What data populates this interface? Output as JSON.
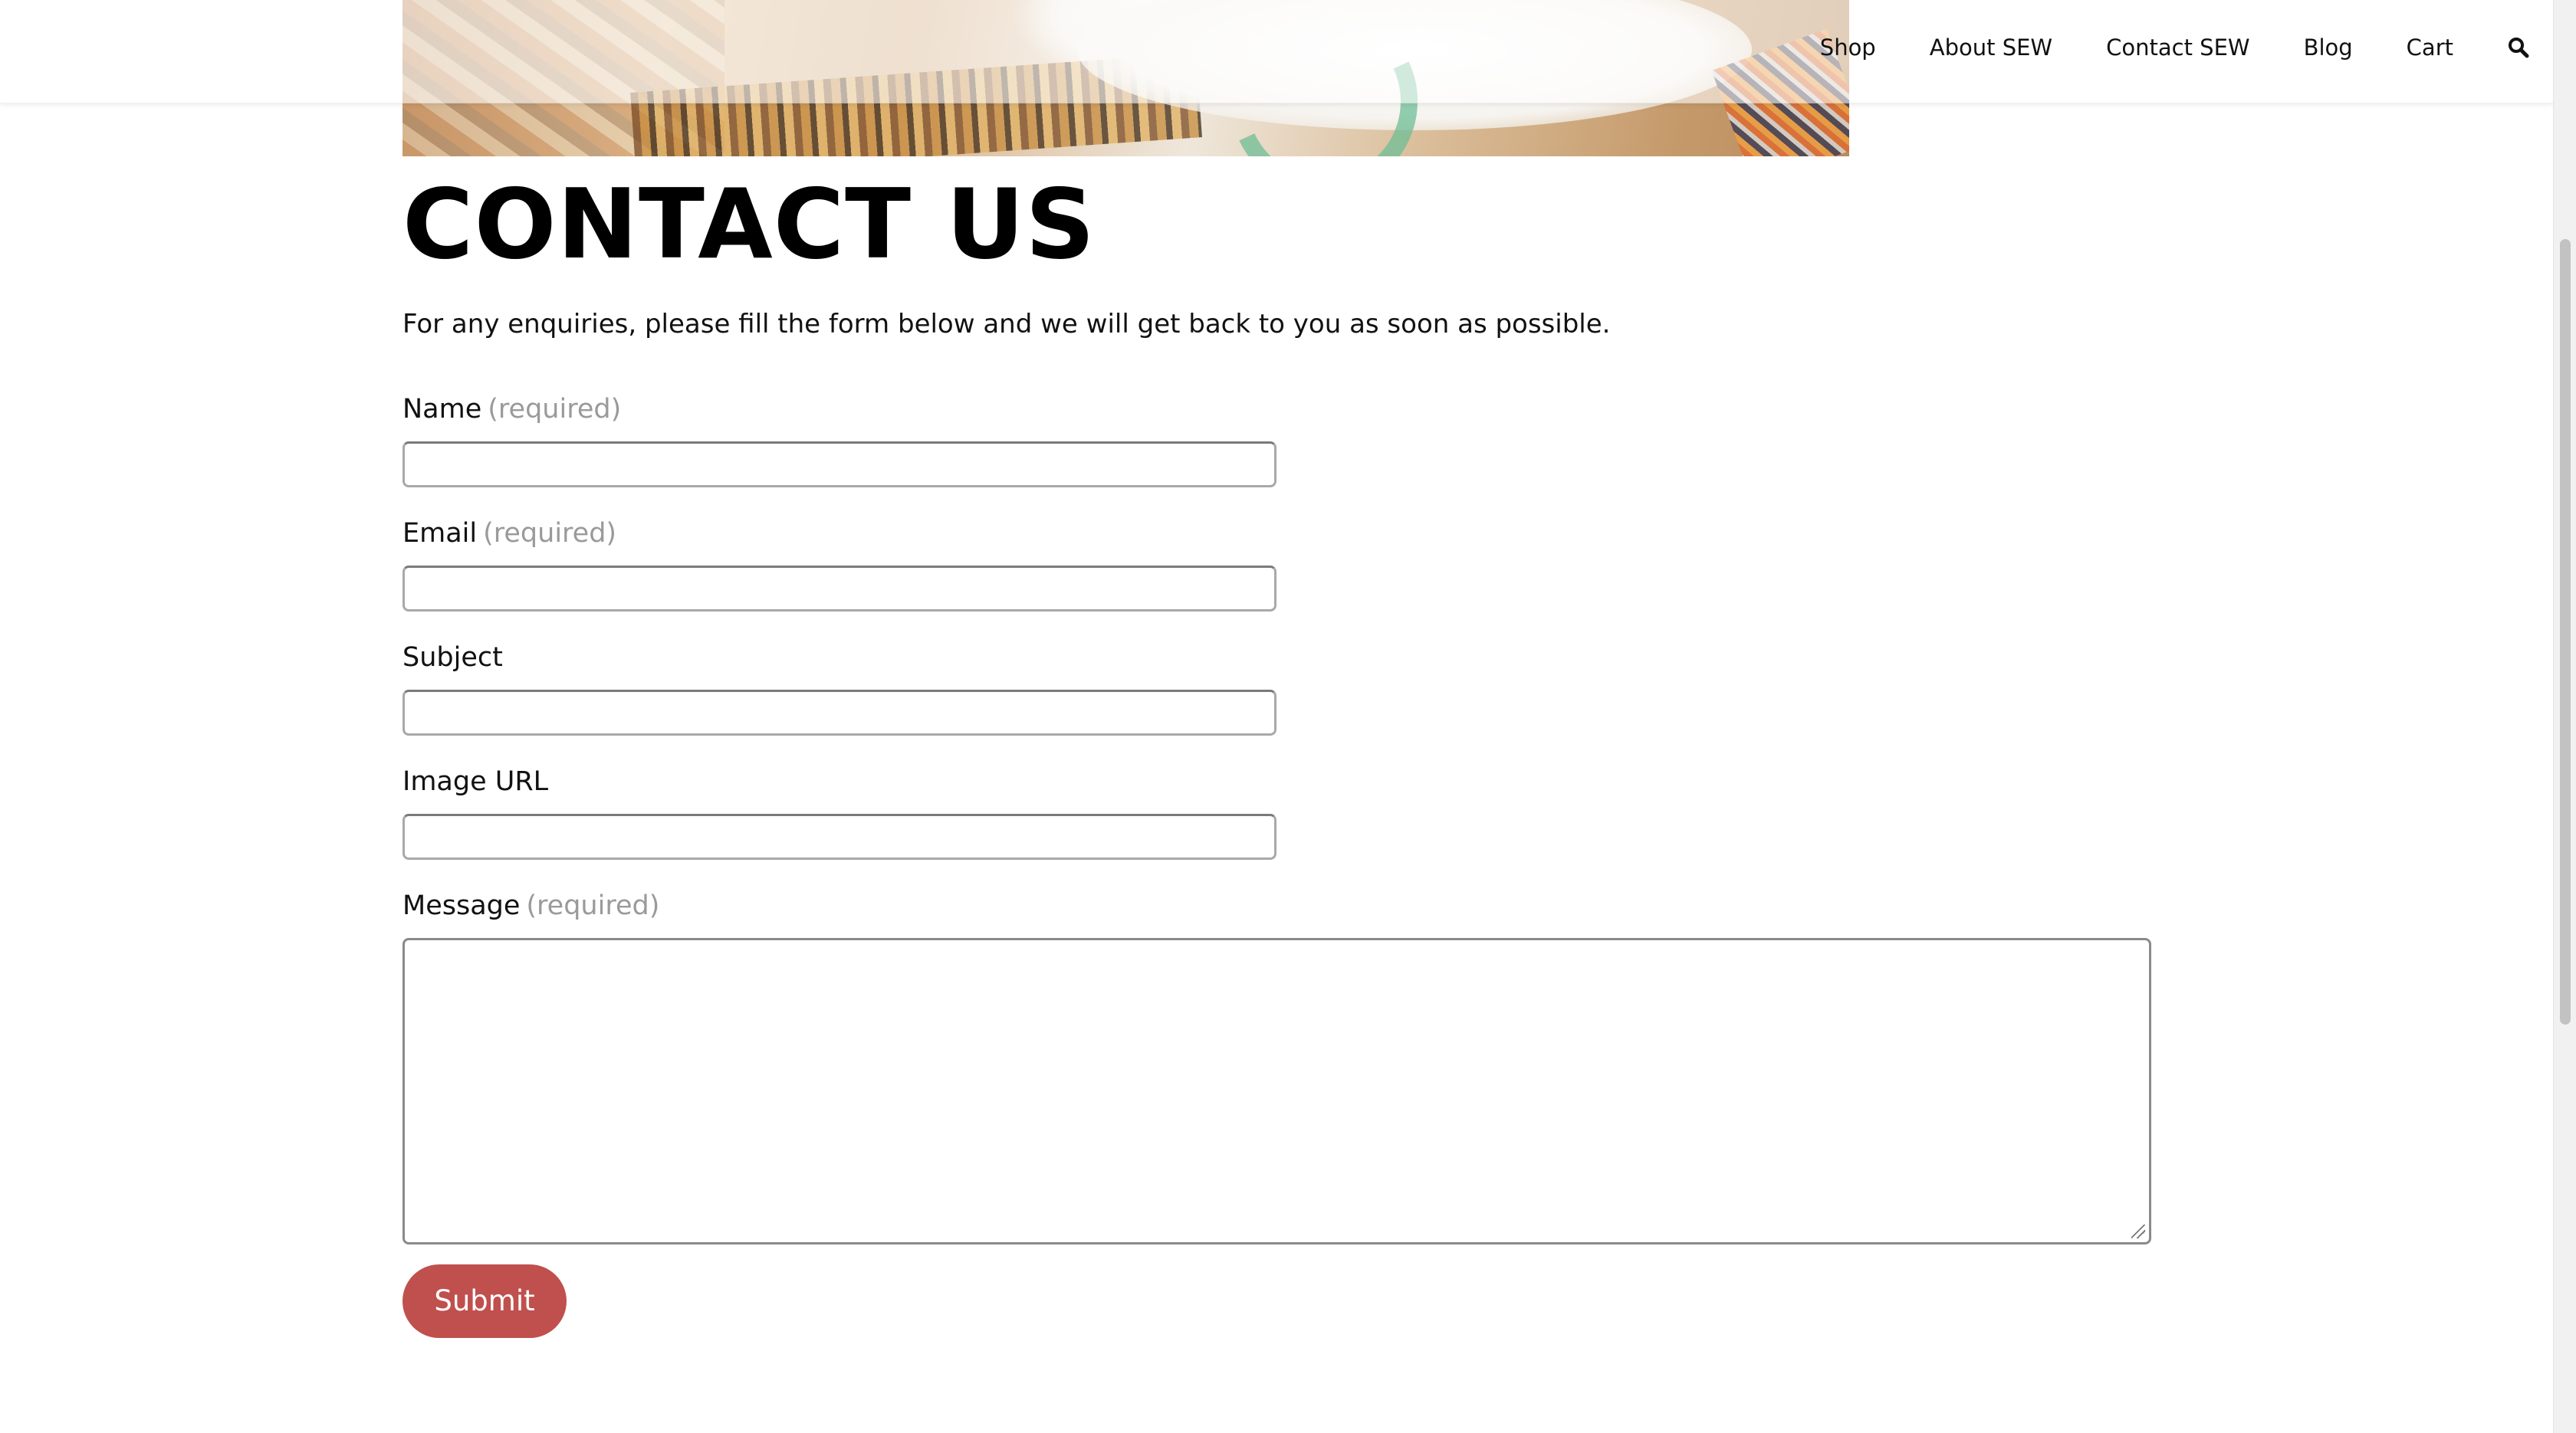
{
  "nav": {
    "items": [
      {
        "label": "Shop"
      },
      {
        "label": "About SEW"
      },
      {
        "label": "Contact SEW"
      },
      {
        "label": "Blog"
      },
      {
        "label": "Cart"
      }
    ],
    "search_icon": "search-icon"
  },
  "page": {
    "title": "CONTACT US",
    "intro": "For any enquiries, please fill the form below and we will get back to you as soon as possible."
  },
  "form": {
    "name": {
      "label": "Name",
      "required": "(required)",
      "value": ""
    },
    "email": {
      "label": "Email",
      "required": "(required)",
      "value": ""
    },
    "subject": {
      "label": "Subject",
      "value": ""
    },
    "image_url": {
      "label": "Image URL",
      "value": ""
    },
    "message": {
      "label": "Message",
      "required": "(required)",
      "value": ""
    },
    "submit_label": "Submit"
  },
  "colors": {
    "accent": "#c0504d",
    "required_text": "#9a9a9a"
  }
}
